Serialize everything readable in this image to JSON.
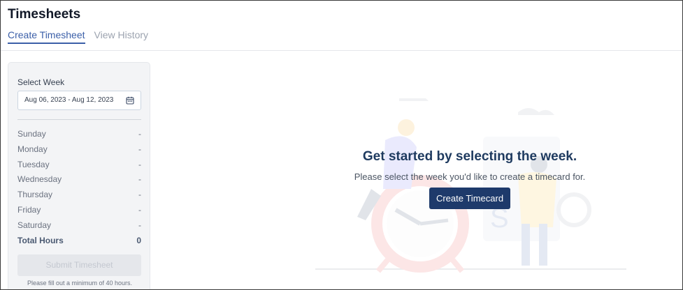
{
  "page": {
    "title": "Timesheets"
  },
  "tabs": [
    {
      "label": "Create Timesheet",
      "active": true
    },
    {
      "label": "View History",
      "active": false
    }
  ],
  "sidebar": {
    "select_week_label": "Select Week",
    "week_value": "Aug 06, 2023 - Aug 12, 2023",
    "calendar_icon": "calendar-icon",
    "days": [
      {
        "day": "Sunday",
        "value": "-"
      },
      {
        "day": "Monday",
        "value": "-"
      },
      {
        "day": "Tuesday",
        "value": "-"
      },
      {
        "day": "Wednesday",
        "value": "-"
      },
      {
        "day": "Thursday",
        "value": "-"
      },
      {
        "day": "Friday",
        "value": "-"
      },
      {
        "day": "Saturday",
        "value": "-"
      }
    ],
    "total_label": "Total Hours",
    "total_value": "0",
    "submit_label": "Submit Timesheet",
    "submit_disabled": true,
    "hint": "Please fill out a minimum of 40 hours."
  },
  "empty_state": {
    "title": "Get started by selecting the week.",
    "subtitle": "Please select the week you'd like to create a timecard for.",
    "button_label": "Create Timecard"
  },
  "colors": {
    "accent": "#3b5fa8",
    "primary_button": "#1e3a6b",
    "heading": "#1e3a5f"
  }
}
